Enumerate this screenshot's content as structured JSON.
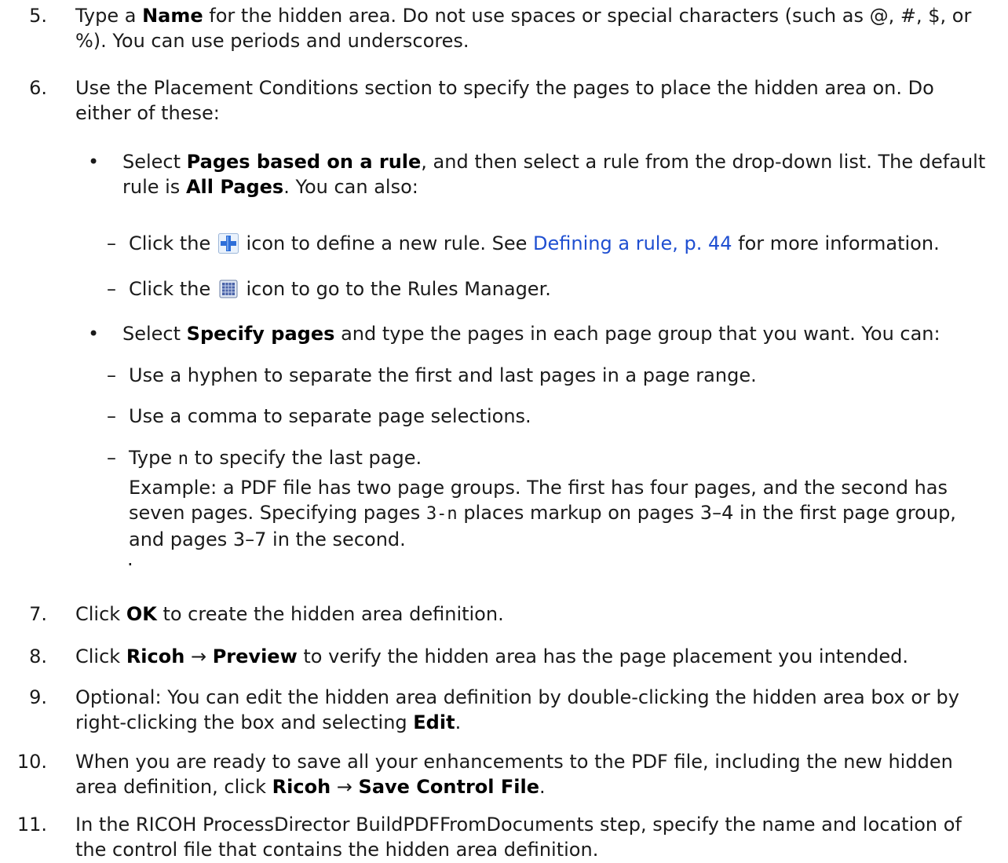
{
  "steps": {
    "s5": {
      "num": "5.",
      "t1": "Type a ",
      "b1": "Name",
      "t2": " for the hidden area. Do not use spaces or special characters (such as @, #, $, or %). You can use periods and underscores."
    },
    "s6": {
      "num": "6.",
      "text": "Use the Placement Conditions section to specify the pages to place the hidden area on. Do either of these:"
    },
    "b1": {
      "mark": "•",
      "t1": "Select ",
      "b1": "Pages based on a rule",
      "t2": ", and then select a rule from the drop-down list. The default rule is ",
      "b2": "All Pages",
      "t3": ". You can also:"
    },
    "d1": {
      "mark": "–",
      "t1": "Click the ",
      "icon": "add-plus-icon",
      "t2": " icon to define a new rule. See ",
      "link": "Defining a rule, p. 44",
      "t3": " for more information."
    },
    "d2": {
      "mark": "–",
      "t1": "Click the ",
      "icon": "rules-manager-grid-icon",
      "t2": " icon to go to the Rules Manager."
    },
    "b2": {
      "mark": "•",
      "t1": "Select ",
      "b1": "Specify pages",
      "t2": " and type the pages in each page group that you want. You can:"
    },
    "d3": {
      "mark": "–",
      "text": "Use a hyphen to separate the first and last pages in a page range."
    },
    "d4": {
      "mark": "–",
      "text": "Use a comma to separate page selections."
    },
    "d5": {
      "mark": "–",
      "t1": "Type ",
      "code": "n",
      "t2": " to specify the last page."
    },
    "example": {
      "t1": "Example: a PDF file has two page groups. The first has four pages, and the second has seven pages. Specifying pages ",
      "code": "3-n",
      "t2": " places markup on pages 3–4 in the first page group, and pages 3–7 in the second."
    },
    "dot": ".",
    "s7": {
      "num": "7.",
      "t1": "Click ",
      "b1": "OK",
      "t2": " to create the hidden area definition."
    },
    "s8": {
      "num": "8.",
      "t1": "Click ",
      "b1": "Ricoh",
      "arrow": " → ",
      "b2": "Preview",
      "t2": " to verify the hidden area has the page placement you intended."
    },
    "s9": {
      "num": "9.",
      "t1": "Optional: You can edit the hidden area definition by double-clicking the hidden area box or by right-clicking the box and selecting ",
      "b1": "Edit",
      "t2": "."
    },
    "s10": {
      "num": "10.",
      "t1": "When you are ready to save all your enhancements to the PDF file, including the new hidden area definition, click ",
      "b1": "Ricoh",
      "arrow": " → ",
      "b2": "Save Control File",
      "t2": "."
    },
    "s11": {
      "num": "11.",
      "text": "In the RICOH ProcessDirector BuildPDFFromDocuments step, specify the name and location of the control file that contains the hidden area definition."
    }
  },
  "colors": {
    "link": "#1f4fd1",
    "icon_plus_bg": "#2f6fd8"
  }
}
